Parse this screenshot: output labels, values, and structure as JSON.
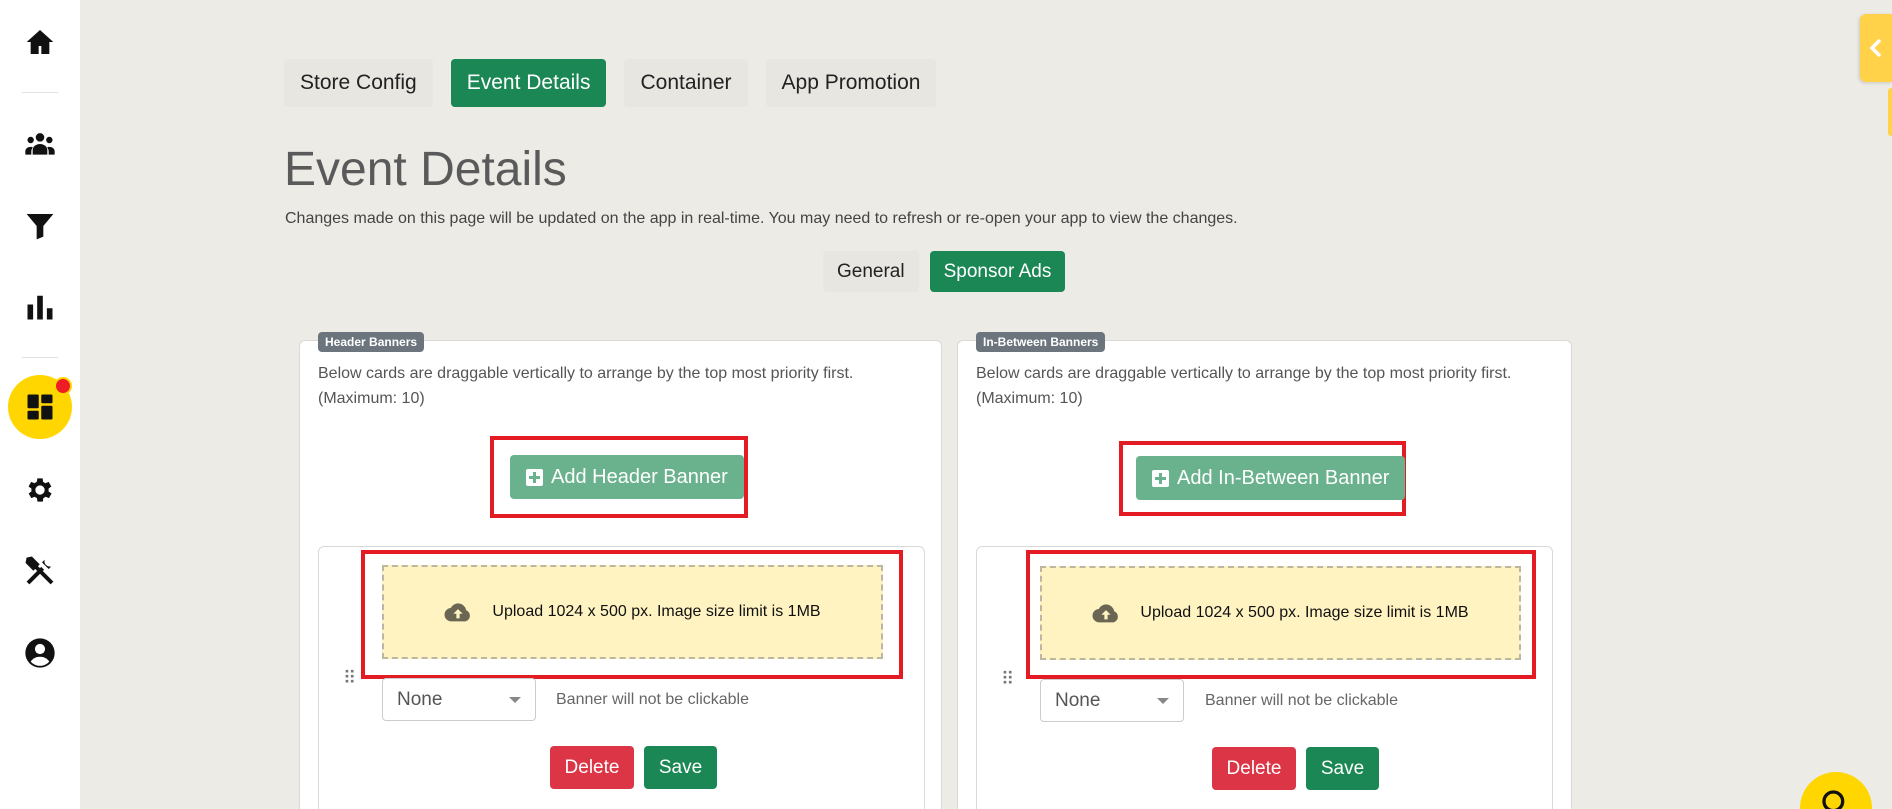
{
  "sidebar": {
    "items": [
      {
        "icon": "home-icon"
      },
      {
        "icon": "users-icon"
      },
      {
        "icon": "filter-icon"
      },
      {
        "icon": "chart-icon"
      },
      {
        "icon": "dashboard-icon",
        "active": true,
        "badge": true
      },
      {
        "icon": "gear-icon"
      },
      {
        "icon": "tools-icon"
      },
      {
        "icon": "account-icon"
      }
    ]
  },
  "tabs": [
    {
      "label": "Store Config",
      "active": false
    },
    {
      "label": "Event Details",
      "active": true
    },
    {
      "label": "Container",
      "active": false
    },
    {
      "label": "App Promotion",
      "active": false
    }
  ],
  "page": {
    "title": "Event Details",
    "description": "Changes made on this page will be updated on the app in real-time. You may need to refresh or re-open your app to view the changes."
  },
  "sub_tabs": [
    {
      "label": "General",
      "active": false
    },
    {
      "label": "Sponsor Ads",
      "active": true
    }
  ],
  "cards": {
    "header": {
      "badge": "Header Banners",
      "description": "Below cards are draggable vertically to arrange by the top most priority first. (Maximum: 10)",
      "add_button": "Add Header Banner",
      "upload_text": "Upload 1024 x 500 px. Image size limit is 1MB",
      "link_select": "None",
      "link_note": "Banner will not be clickable",
      "delete_label": "Delete",
      "save_label": "Save"
    },
    "inbetween": {
      "badge": "In-Between Banners",
      "description": "Below cards are draggable vertically to arrange by the top most priority first. (Maximum: 10)",
      "add_button": "Add In-Between Banner",
      "upload_text": "Upload 1024 x 500 px. Image size limit is 1MB",
      "link_select": "None",
      "link_note": "Banner will not be clickable",
      "delete_label": "Delete",
      "save_label": "Save"
    }
  },
  "colors": {
    "primary": "#1a8754",
    "accent": "#ffd600",
    "danger": "#dc3545",
    "highlight": "#e31b23"
  }
}
